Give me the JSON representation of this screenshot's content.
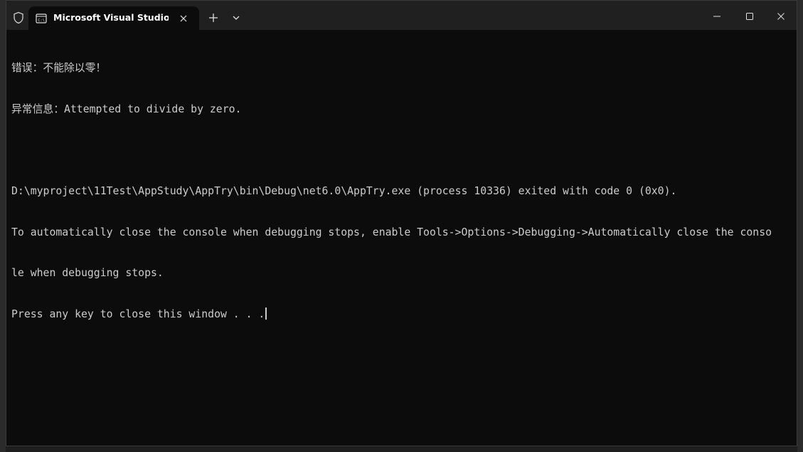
{
  "window": {
    "tab_title": "Microsoft Visual Studio Debug",
    "icons": {
      "shield": "shield-icon",
      "tab_icon": "console-icon",
      "tab_close": "close-icon",
      "new_tab": "plus-icon",
      "dropdown": "chevron-down-icon",
      "minimize": "minimize-icon",
      "maximize": "maximize-icon",
      "close": "close-icon"
    },
    "colors": {
      "titlebar_bg": "#202020",
      "console_bg": "#0c0c0c",
      "console_fg": "#cccccc"
    }
  },
  "console": {
    "lines": [
      "错误：不能除以零！",
      "异常信息：Attempted to divide by zero.",
      "",
      "D:\\myproject\\11Test\\AppStudy\\AppTry\\bin\\Debug\\net6.0\\AppTry.exe (process 10336) exited with code 0 (0x0).",
      "To automatically close the console when debugging stops, enable Tools->Options->Debugging->Automatically close the conso",
      "le when debugging stops.",
      "Press any key to close this window . . ."
    ]
  }
}
